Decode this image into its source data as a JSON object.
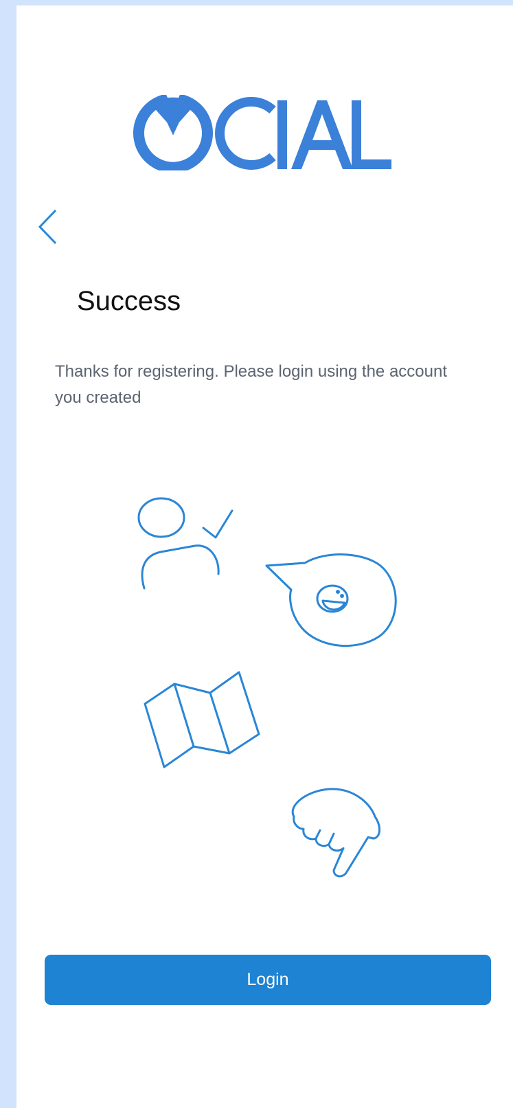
{
  "brand": {
    "logo_text": "OCIAL",
    "color": "#3b80d9"
  },
  "nav": {
    "back_icon": "chevron-left-icon"
  },
  "content": {
    "title": "Success",
    "message": "Thanks for registering. Please login using the account you created"
  },
  "illustration": {
    "icons": [
      "user-check-icon",
      "speech-bubble-smiley-icon",
      "folded-map-icon",
      "pointing-hand-icon"
    ],
    "stroke_color": "#2a86d6"
  },
  "actions": {
    "login_label": "Login",
    "login_color": "#1e83d2"
  }
}
